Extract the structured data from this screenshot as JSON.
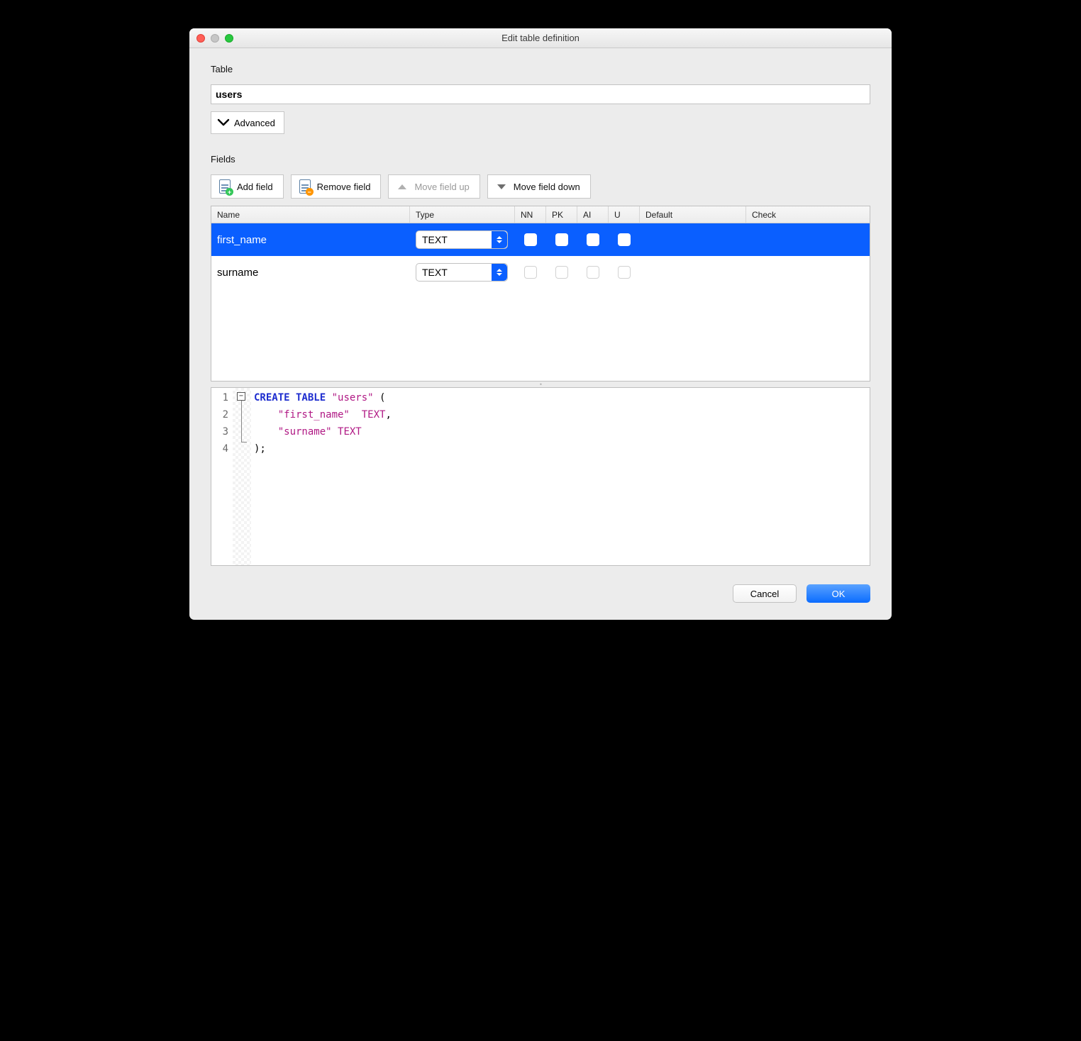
{
  "window": {
    "title": "Edit table definition"
  },
  "labels": {
    "table": "Table",
    "advanced": "Advanced",
    "fields": "Fields"
  },
  "table": {
    "name": "users"
  },
  "toolbar": {
    "add": "Add field",
    "remove": "Remove field",
    "moveUp": "Move field up",
    "moveDown": "Move field down"
  },
  "gridHeaders": {
    "name": "Name",
    "type": "Type",
    "nn": "NN",
    "pk": "PK",
    "ai": "AI",
    "u": "U",
    "default": "Default",
    "check": "Check"
  },
  "fields": [
    {
      "name": "first_name",
      "type": "TEXT",
      "nn": false,
      "pk": false,
      "ai": false,
      "u": false,
      "default": "",
      "check": "",
      "selected": true
    },
    {
      "name": "surname",
      "type": "TEXT",
      "nn": false,
      "pk": false,
      "ai": false,
      "u": false,
      "default": "",
      "check": "",
      "selected": false
    }
  ],
  "sql": {
    "lines": [
      "1",
      "2",
      "3",
      "4"
    ],
    "create": "CREATE TABLE",
    "tableQuoted": "\"users\"",
    "openParen": " (",
    "field1": "\"first_name\"",
    "type1": "TEXT",
    "comma": ",",
    "field2": "\"surname\"",
    "type2": "TEXT",
    "close": ");"
  },
  "footer": {
    "cancel": "Cancel",
    "ok": "OK"
  }
}
